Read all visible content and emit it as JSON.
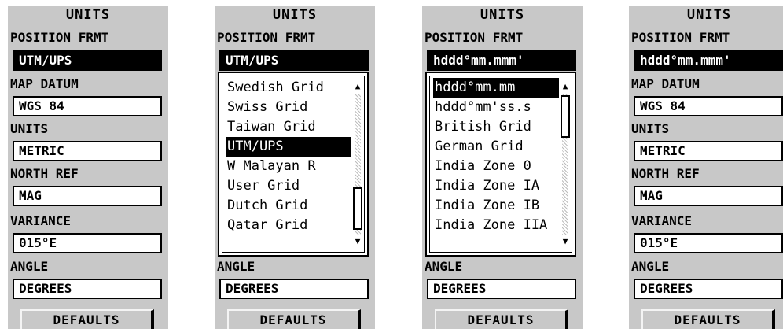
{
  "screens": [
    {
      "title": "UNITS",
      "position_label": "POSITION FRMT",
      "position_value": "UTM/UPS",
      "map_datum_label": "MAP DATUM",
      "map_datum_value": "WGS 84",
      "units_label": "UNITS",
      "units_value": "METRIC",
      "north_ref_label": "NORTH REF",
      "north_ref_value": "MAG",
      "variance_label": "VARIANCE",
      "variance_value": "015°E",
      "angle_label": "ANGLE",
      "angle_value": "DEGREES",
      "defaults_label": "DEFAULTS"
    },
    {
      "title": "UNITS",
      "position_label": "POSITION FRMT",
      "position_value": "UTM/UPS",
      "list_items": [
        "Swedish Grid",
        "Swiss Grid",
        "Taiwan Grid",
        "UTM/UPS",
        "W Malayan R",
        "User Grid",
        "Dutch Grid",
        "Qatar Grid"
      ],
      "selected_index": 3,
      "angle_label": "ANGLE",
      "angle_value": "DEGREES",
      "defaults_label": "DEFAULTS"
    },
    {
      "title": "UNITS",
      "position_label": "POSITION FRMT",
      "position_value": "hddd°mm.mmm'",
      "list_items": [
        "hddd°mm.mm",
        "hddd°mm'ss.s",
        "British Grid",
        "German Grid",
        "India Zone 0",
        "India Zone IA",
        "India Zone IB",
        "India Zone IIA"
      ],
      "selected_index": 0,
      "angle_label": "ANGLE",
      "angle_value": "DEGREES",
      "defaults_label": "DEFAULTS"
    },
    {
      "title": "UNITS",
      "position_label": "POSITION FRMT",
      "position_value": "hddd°mm.mmm'",
      "map_datum_label": "MAP DATUM",
      "map_datum_value": "WGS 84",
      "units_label": "UNITS",
      "units_value": "METRIC",
      "north_ref_label": "NORTH REF",
      "north_ref_value": "MAG",
      "variance_label": "VARIANCE",
      "variance_value": "015°E",
      "angle_label": "ANGLE",
      "angle_value": "DEGREES",
      "defaults_label": "DEFAULTS"
    }
  ]
}
